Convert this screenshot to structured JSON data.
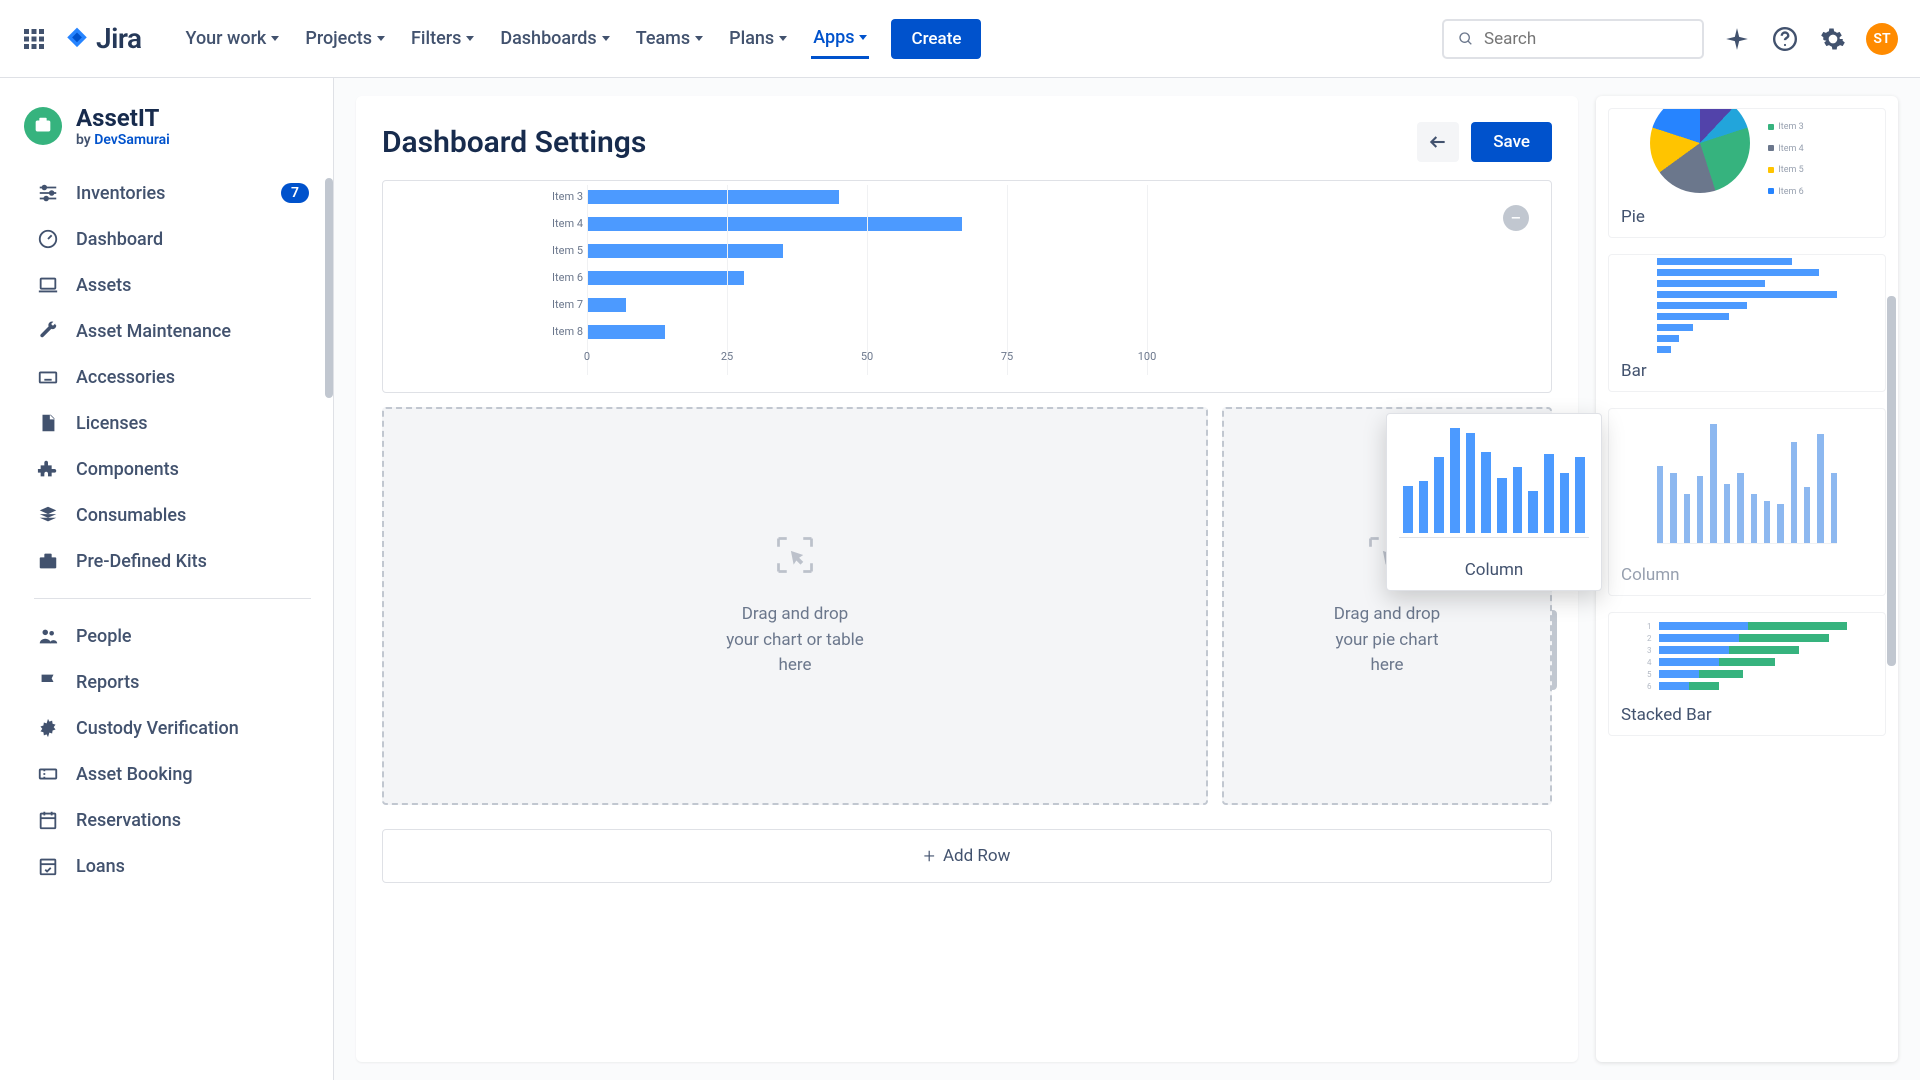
{
  "header": {
    "brand": "Jira",
    "nav": [
      {
        "label": "Your work"
      },
      {
        "label": "Projects"
      },
      {
        "label": "Filters"
      },
      {
        "label": "Dashboards"
      },
      {
        "label": "Teams"
      },
      {
        "label": "Plans"
      },
      {
        "label": "Apps",
        "active": true
      }
    ],
    "create": "Create",
    "search_placeholder": "Search",
    "avatar_initials": "ST"
  },
  "sidebar": {
    "app_name": "AssetIT",
    "by_text": "by ",
    "by_link": "DevSamurai",
    "items": [
      {
        "label": "Inventories",
        "badge": "7"
      },
      {
        "label": "Dashboard"
      },
      {
        "label": "Assets"
      },
      {
        "label": "Asset Maintenance"
      },
      {
        "label": "Accessories"
      },
      {
        "label": "Licenses"
      },
      {
        "label": "Components"
      },
      {
        "label": "Consumables"
      },
      {
        "label": "Pre-Defined Kits"
      }
    ],
    "items2": [
      {
        "label": "People"
      },
      {
        "label": "Reports"
      },
      {
        "label": "Custody Verification"
      },
      {
        "label": "Asset Booking"
      },
      {
        "label": "Reservations"
      },
      {
        "label": "Loans"
      }
    ]
  },
  "main": {
    "title": "Dashboard Settings",
    "save": "Save",
    "drop1_l1": "Drag and drop",
    "drop1_l2": "your chart or table",
    "drop1_l3": "here",
    "drop2_l1": "Drag and drop",
    "drop2_l2": "your pie chart",
    "drop2_l3": "here",
    "drag_label": "Column",
    "add_row": "Add Row"
  },
  "panel": {
    "widgets": [
      {
        "label": "Pie"
      },
      {
        "label": "Bar"
      },
      {
        "label": "Column"
      },
      {
        "label": "Stacked Bar"
      }
    ]
  },
  "chart_data": {
    "type": "bar",
    "orientation": "horizontal",
    "categories": [
      "Item 3",
      "Item 4",
      "Item 5",
      "Item 6",
      "Item 7",
      "Item 8"
    ],
    "values": [
      45,
      67,
      35,
      28,
      7,
      14
    ],
    "xlim": [
      0,
      100
    ],
    "xticks": [
      0,
      25,
      50,
      75,
      100
    ],
    "title": "",
    "xlabel": "",
    "ylabel": ""
  },
  "drag_preview_data": {
    "type": "bar",
    "values": [
      36,
      40,
      58,
      80,
      76,
      62,
      42,
      50,
      32,
      60,
      46,
      58
    ]
  },
  "mini_column_data": {
    "type": "bar",
    "values": [
      55,
      50,
      35,
      48,
      85,
      42,
      50,
      35,
      30,
      28,
      72,
      40,
      78,
      50
    ]
  }
}
